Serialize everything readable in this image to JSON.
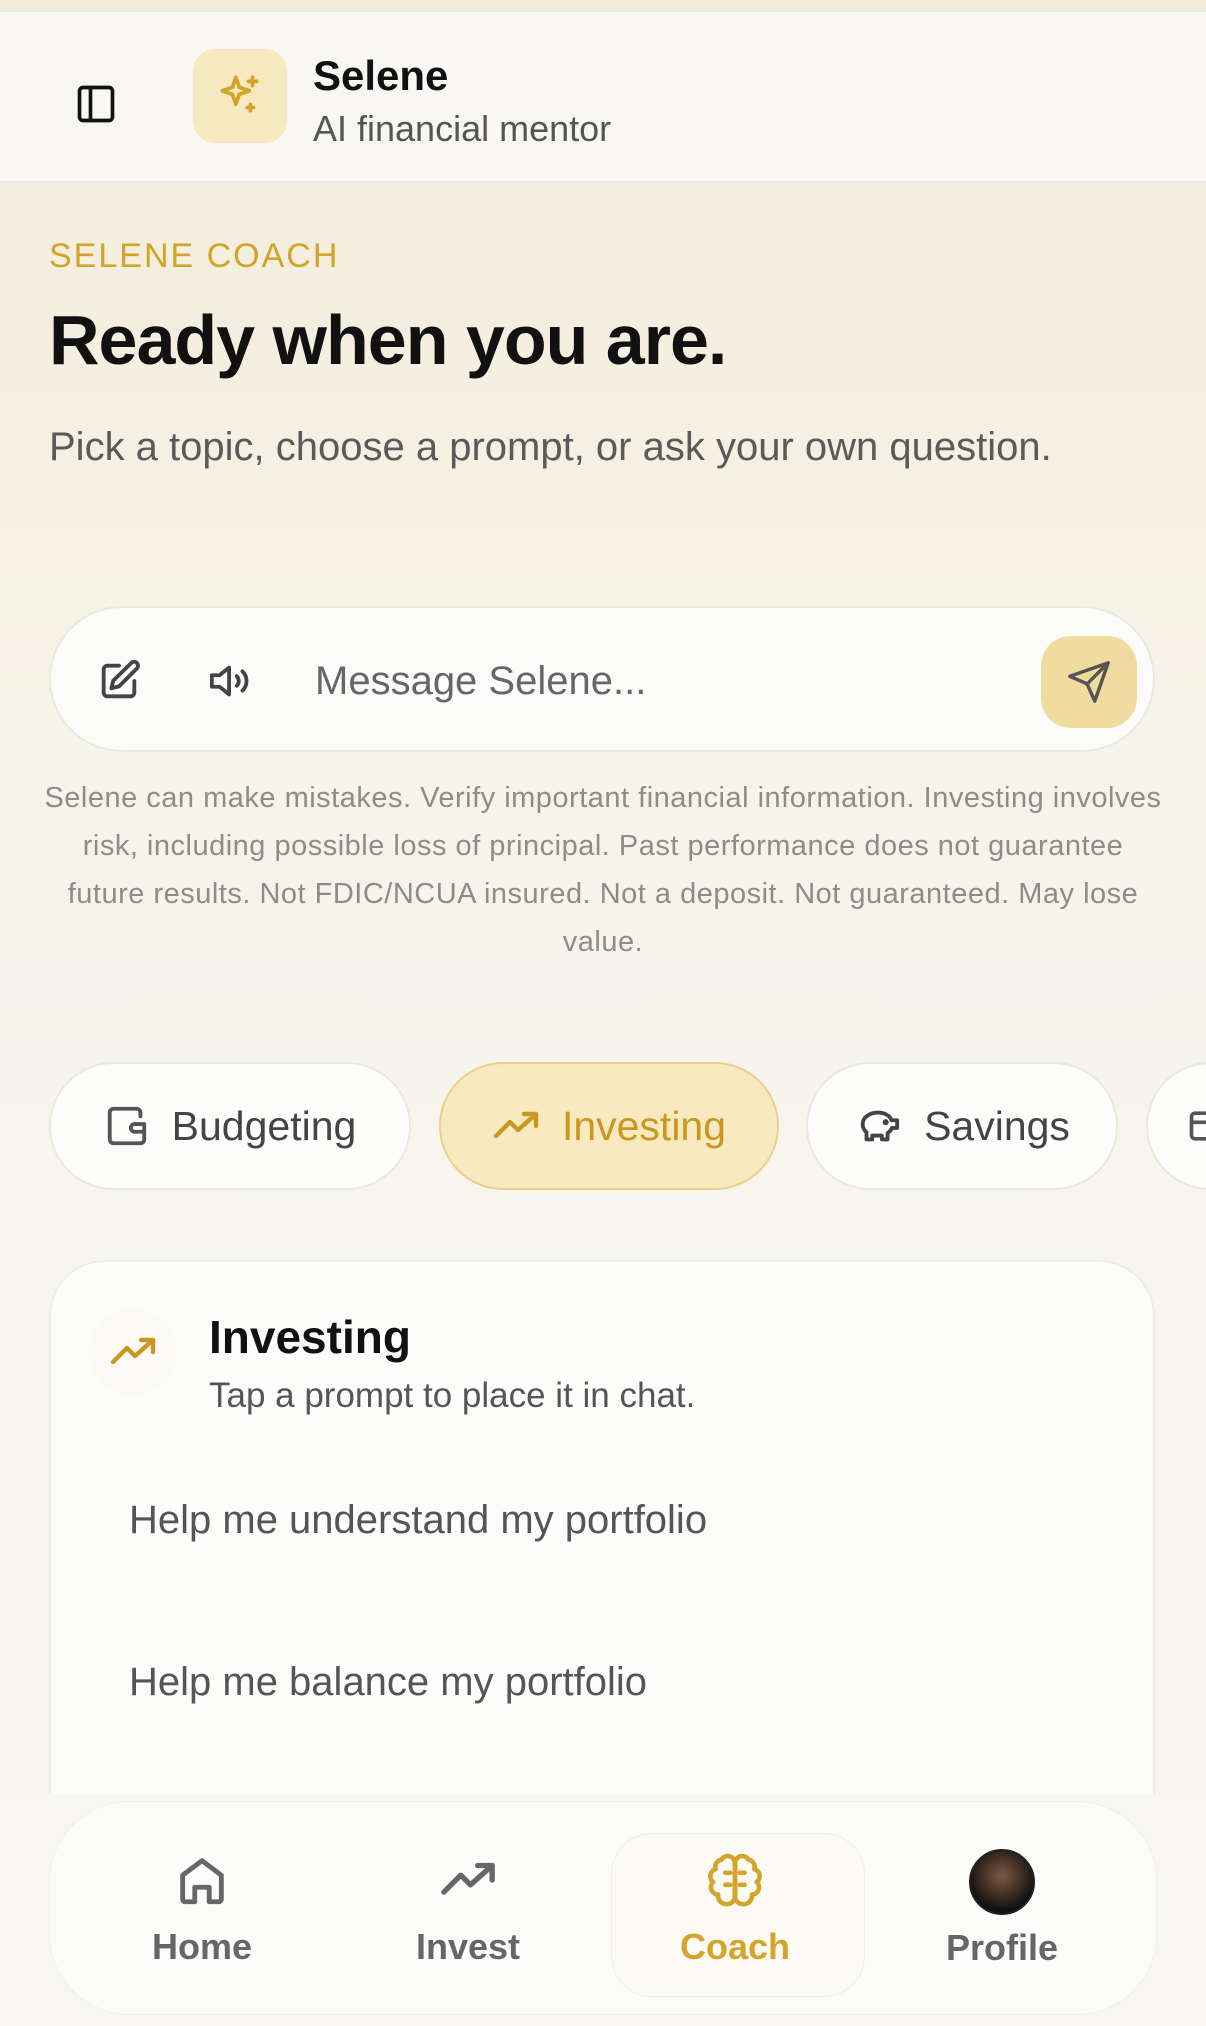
{
  "header": {
    "title": "Selene",
    "subtitle": "AI financial mentor",
    "sidebar_icon": "sidebar-icon",
    "app_icon": "sparkles-icon"
  },
  "hero": {
    "eyebrow": "SELENE COACH",
    "headline": "Ready when you are.",
    "subhead": "Pick a topic, choose a prompt, or ask your own question."
  },
  "composer": {
    "placeholder": "Message Selene...",
    "value": "",
    "edit_icon": "edit-icon",
    "voice_icon": "speaker-icon",
    "send_icon": "send-icon"
  },
  "disclaimer": "Selene can make mistakes. Verify important financial information. Investing involves risk, including possible loss of principal. Past performance does not guarantee future results. Not FDIC/NCUA insured. Not a deposit. Not guaranteed. May lose value.",
  "topics": [
    {
      "label": "Budgeting",
      "icon": "wallet-icon",
      "active": false
    },
    {
      "label": "Investing",
      "icon": "trending-up-icon",
      "active": true
    },
    {
      "label": "Savings",
      "icon": "piggy-bank-icon",
      "active": false
    }
  ],
  "card": {
    "title": "Investing",
    "subtitle": "Tap a prompt to place it in chat.",
    "icon": "trending-up-icon",
    "prompts": [
      "Help me understand my portfolio",
      "Help me balance my portfolio"
    ]
  },
  "tabbar": [
    {
      "label": "Home",
      "icon": "home-icon",
      "active": false
    },
    {
      "label": "Invest",
      "icon": "trending-up-icon",
      "active": false
    },
    {
      "label": "Coach",
      "icon": "brain-icon",
      "active": true
    },
    {
      "label": "Profile",
      "icon": "avatar",
      "active": false
    }
  ],
  "colors": {
    "accent": "#d2a428",
    "accent_soft": "#f8e9c0",
    "text": "#111111",
    "muted": "#8c8c8c"
  }
}
